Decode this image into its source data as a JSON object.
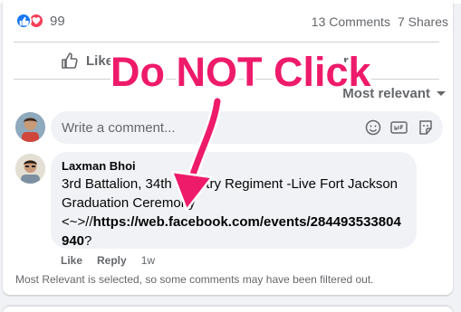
{
  "post": {
    "reaction_count": "99",
    "comments_count": "13 Comments",
    "shares_count": "7 Shares"
  },
  "actions": {
    "like_label": "Like",
    "share_label_partial": "re"
  },
  "sort": {
    "label": "Most relevant"
  },
  "composer": {
    "placeholder": "Write a comment..."
  },
  "comment": {
    "author": "Laxman Bhoi",
    "line1": "3rd Battalion, 34th Infantry Regiment -Live Fort Jackson",
    "line2": "Graduation Ceremony",
    "prefix": "<~>//",
    "link": "https://web.facebook.com/events/284493533804",
    "link_tail": "940",
    "suffix": "?",
    "like_label": "Like",
    "reply_label": "Reply",
    "time": "1w"
  },
  "filter_note": "Most Relevant is selected, so some comments may have been filtered out.",
  "overlay": {
    "text": "Do NOT Click",
    "color": "#ee1a6a"
  },
  "colors": {
    "facebook_blue": "#1877f2",
    "love_red": "#f33e58",
    "secondary_text": "#65676b"
  },
  "icons": [
    "like-reaction-icon",
    "love-reaction-icon",
    "like-thumb-icon",
    "share-icon",
    "caret-down-icon",
    "emoji-icon",
    "gif-icon",
    "sticker-icon",
    "arrow-icon"
  ]
}
